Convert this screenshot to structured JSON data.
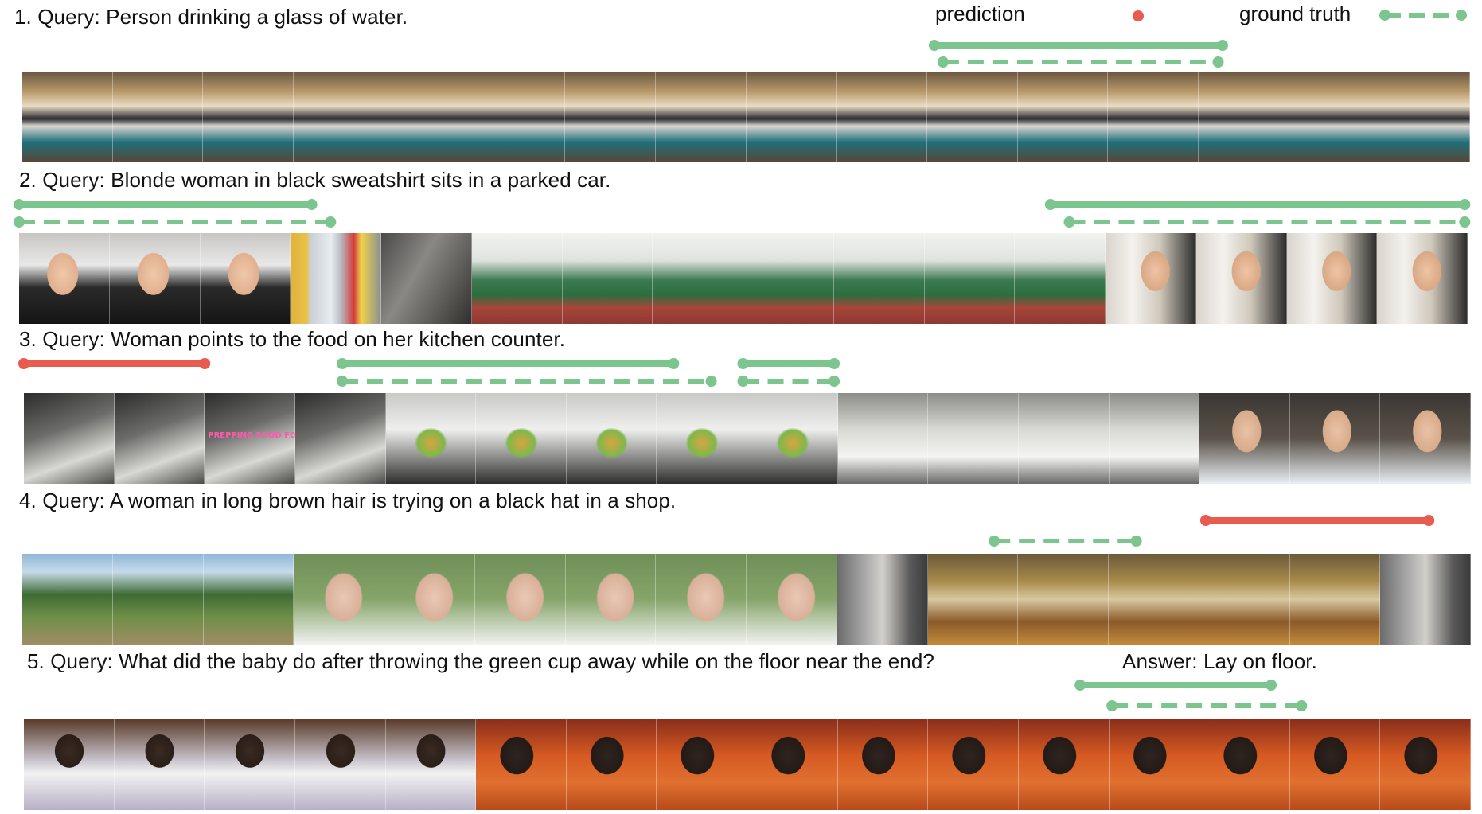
{
  "legend": {
    "prediction_label": "prediction",
    "ground_truth_label": "ground truth",
    "prediction_gradient": [
      "#7cc58e",
      "#e85b4f"
    ],
    "ground_truth_color": "#7cc58e"
  },
  "colors": {
    "correct": "#7cc58e",
    "wrong": "#e85b4f"
  },
  "examples": [
    {
      "query": "1. Query: Person drinking a glass of water.",
      "frames": 16,
      "scene": "laundry",
      "predictions": [
        {
          "start": 0.63,
          "end": 0.829,
          "correct": true
        }
      ],
      "ground_truth": [
        {
          "start": 0.636,
          "end": 0.826
        }
      ]
    },
    {
      "query": "2. Query: Blonde woman in black sweatshirt sits in a parked car.",
      "frames": 16,
      "scene": "car_field_car",
      "predictions": [
        {
          "start": 0.0,
          "end": 0.202,
          "correct": true
        },
        {
          "start": 0.712,
          "end": 0.998,
          "correct": true
        }
      ],
      "ground_truth": [
        {
          "start": 0.0,
          "end": 0.215
        },
        {
          "start": 0.725,
          "end": 0.998
        }
      ]
    },
    {
      "query": "3. Query: Woman points to the food on her kitchen counter.",
      "frames": 16,
      "scene": "kitchen",
      "overlay_text": "PREPPING FOOD FOR WORK",
      "predictions": [
        {
          "start": 0.0,
          "end": 0.125,
          "correct": false
        },
        {
          "start": 0.22,
          "end": 0.449,
          "correct": true
        },
        {
          "start": 0.497,
          "end": 0.56,
          "correct": true
        }
      ],
      "ground_truth": [
        {
          "start": 0.22,
          "end": 0.475
        },
        {
          "start": 0.497,
          "end": 0.56
        }
      ]
    },
    {
      "query": "4. Query: A woman in long brown hair is trying on a black hat in a shop.",
      "frames": 16,
      "scene": "park_shop",
      "predictions": [
        {
          "start": 0.817,
          "end": 0.971,
          "correct": false
        }
      ],
      "ground_truth": [
        {
          "start": 0.671,
          "end": 0.769
        }
      ]
    },
    {
      "query": "5. Query: What did the baby do after throwing the green cup away while on the floor near the end?",
      "answer": "Answer: Lay on floor.",
      "frames": 16,
      "scene": "baby",
      "predictions": [
        {
          "start": 0.73,
          "end": 0.862,
          "correct": true
        }
      ],
      "ground_truth": [
        {
          "start": 0.752,
          "end": 0.883
        }
      ]
    }
  ]
}
